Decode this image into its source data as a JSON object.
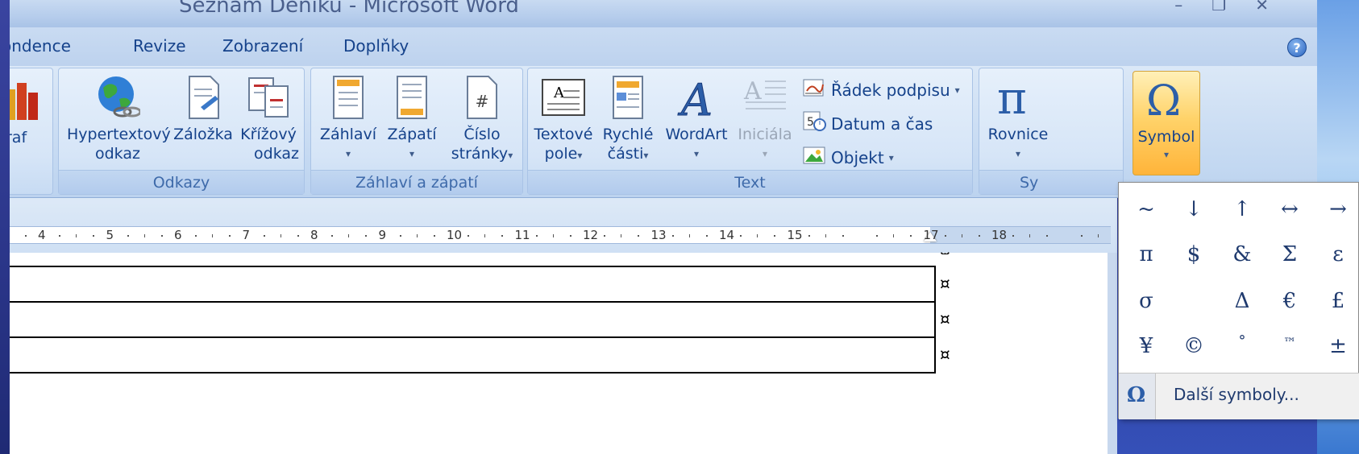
{
  "window": {
    "title": "Seznam Deníků - Microsoft Word",
    "controls": [
      "–",
      "❐",
      "✕"
    ]
  },
  "tabs": [
    "ondence",
    "Revize",
    "Zobrazení",
    "Doplňky"
  ],
  "help": "?",
  "ribbon": {
    "chart_partial_label": "raf",
    "groups": {
      "odkazy": {
        "label": "Odkazy",
        "hyperlink": [
          "Hypertextový",
          "odkaz"
        ],
        "bookmark": "Záložka",
        "crossref": [
          "Křížový",
          "odkaz"
        ]
      },
      "header_footer": {
        "label": "Záhlaví a zápatí",
        "header": "Záhlaví",
        "footer": "Zápatí",
        "page_number": [
          "Číslo",
          "stránky"
        ]
      },
      "text": {
        "label": "Text",
        "textbox": [
          "Textové",
          "pole"
        ],
        "quickparts": [
          "Rychlé",
          "části"
        ],
        "wordart": "WordArt",
        "dropcap": "Iniciála",
        "signature_line": "Řádek podpisu",
        "date_time": "Datum a čas",
        "object": "Objekt"
      },
      "symbols": {
        "label_partial": "Sy",
        "equation": "Rovnice",
        "symbol": "Symbol"
      }
    }
  },
  "ruler": {
    "numbers": [
      "4",
      "5",
      "6",
      "7",
      "8",
      "9",
      "10",
      "11",
      "12",
      "13",
      "14",
      "15",
      "17",
      "18"
    ]
  },
  "document": {
    "cell_mark": "¤"
  },
  "symbol_panel": {
    "rows": [
      [
        "~",
        "↓",
        "↑",
        "↔",
        "→"
      ],
      [
        "π",
        "$",
        "&",
        "Σ",
        "ε"
      ],
      [
        "σ",
        "",
        "Δ",
        "€",
        "£"
      ],
      [
        "¥",
        "©",
        "°",
        "™",
        "±"
      ]
    ],
    "more_symbols": "Další symboly...",
    "omega": "Ω"
  },
  "colors": {
    "ribbon_text": "#15428b",
    "active_button": "#ffc25a",
    "slide_background": "#26327e"
  }
}
